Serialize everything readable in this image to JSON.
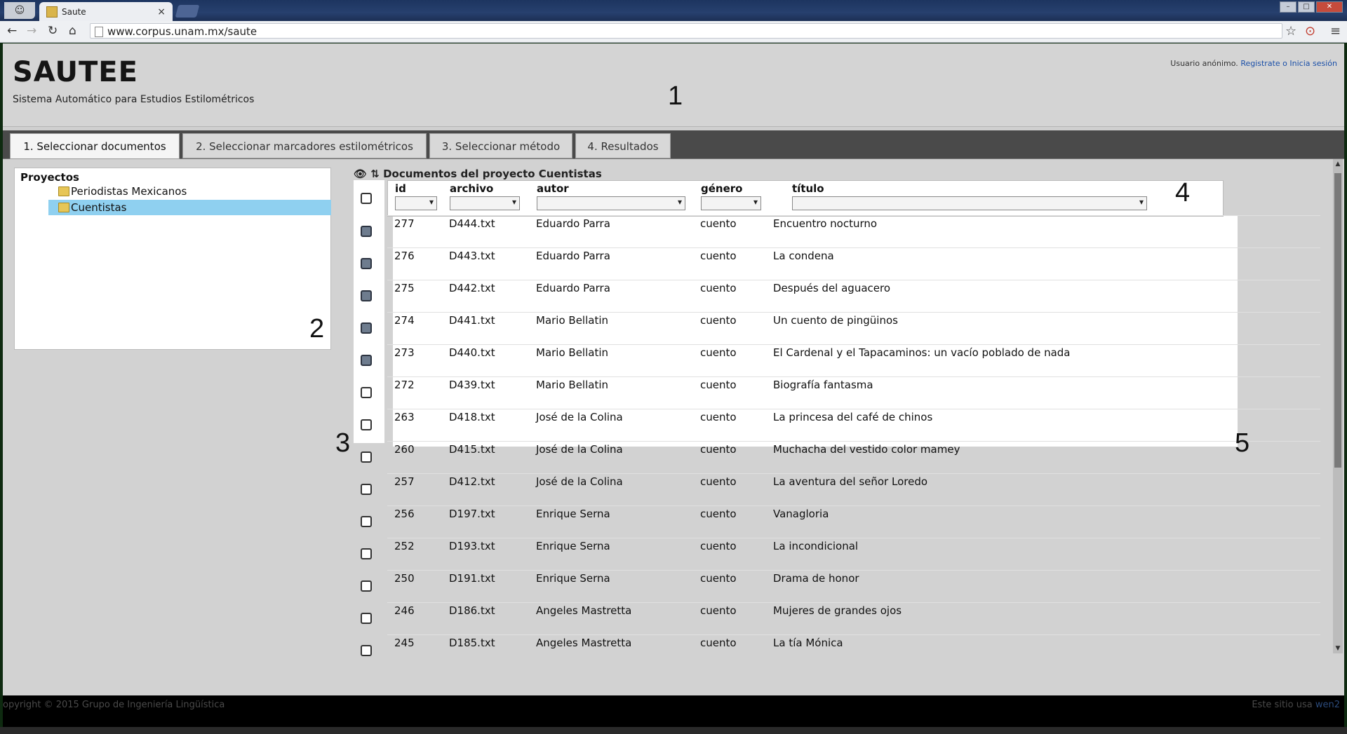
{
  "browser": {
    "tab_title": "Saute",
    "tab_close": "×",
    "url": "www.corpus.unam.mx/saute"
  },
  "header": {
    "logo": "SAUTEE",
    "subtitle": "Sistema Automático para Estudios Estilométricos",
    "user_text": "Usuario anónimo.",
    "register_link": "Registrate",
    "or_text": "o",
    "login_link": "Inicia sesión"
  },
  "steps": [
    {
      "label": "1. Seleccionar documentos"
    },
    {
      "label": "2. Seleccionar marcadores estilométricos"
    },
    {
      "label": "3. Seleccionar método"
    },
    {
      "label": "4. Resultados"
    }
  ],
  "annotations": {
    "n1": "1",
    "n2": "2",
    "n3": "3",
    "n4": "4",
    "n5": "5"
  },
  "tree": {
    "title": "Proyectos",
    "items": [
      {
        "label": "Periodistas Mexicanos"
      },
      {
        "label": "Cuentistas"
      }
    ]
  },
  "documents": {
    "title": "Documentos del proyecto Cuentistas",
    "icons": "👁 ⇅",
    "columns": {
      "id": "id",
      "archivo": "archivo",
      "autor": "autor",
      "genero": "género",
      "titulo": "título"
    },
    "rows": [
      {
        "id": "277",
        "archivo": "D444.txt",
        "autor": "Eduardo Parra",
        "genero": "cuento",
        "titulo": "Encuentro nocturno",
        "checked": true
      },
      {
        "id": "276",
        "archivo": "D443.txt",
        "autor": "Eduardo Parra",
        "genero": "cuento",
        "titulo": "La condena",
        "checked": true
      },
      {
        "id": "275",
        "archivo": "D442.txt",
        "autor": "Eduardo Parra",
        "genero": "cuento",
        "titulo": "Después del aguacero",
        "checked": true
      },
      {
        "id": "274",
        "archivo": "D441.txt",
        "autor": "Mario Bellatin",
        "genero": "cuento",
        "titulo": "Un cuento de pingüinos",
        "checked": true
      },
      {
        "id": "273",
        "archivo": "D440.txt",
        "autor": "Mario Bellatin",
        "genero": "cuento",
        "titulo": "El Cardenal y el Tapacaminos: un vacío poblado de nada",
        "checked": true
      },
      {
        "id": "272",
        "archivo": "D439.txt",
        "autor": "Mario Bellatin",
        "genero": "cuento",
        "titulo": "Biografía fantasma",
        "checked": false
      },
      {
        "id": "263",
        "archivo": "D418.txt",
        "autor": "José de la Colina",
        "genero": "cuento",
        "titulo": "La princesa del café de chinos",
        "checked": false
      },
      {
        "id": "260",
        "archivo": "D415.txt",
        "autor": "José de la Colina",
        "genero": "cuento",
        "titulo": "Muchacha del vestido color mamey",
        "checked": false
      },
      {
        "id": "257",
        "archivo": "D412.txt",
        "autor": "José de la Colina",
        "genero": "cuento",
        "titulo": "La aventura del señor Loredo",
        "checked": false
      },
      {
        "id": "256",
        "archivo": "D197.txt",
        "autor": "Enrique Serna",
        "genero": "cuento",
        "titulo": "Vanagloria",
        "checked": false
      },
      {
        "id": "252",
        "archivo": "D193.txt",
        "autor": "Enrique Serna",
        "genero": "cuento",
        "titulo": "La incondicional",
        "checked": false
      },
      {
        "id": "250",
        "archivo": "D191.txt",
        "autor": "Enrique Serna",
        "genero": "cuento",
        "titulo": "Drama de honor",
        "checked": false
      },
      {
        "id": "246",
        "archivo": "D186.txt",
        "autor": "Angeles Mastretta",
        "genero": "cuento",
        "titulo": "Mujeres de grandes ojos",
        "checked": false
      },
      {
        "id": "245",
        "archivo": "D185.txt",
        "autor": "Angeles Mastretta",
        "genero": "cuento",
        "titulo": "La tía Mónica",
        "checked": false
      }
    ]
  },
  "footer": {
    "left": "opyright © 2015 Grupo de Ingeniería Lingüística",
    "right_text": "Este sitio usa",
    "right_link": "wen2"
  }
}
